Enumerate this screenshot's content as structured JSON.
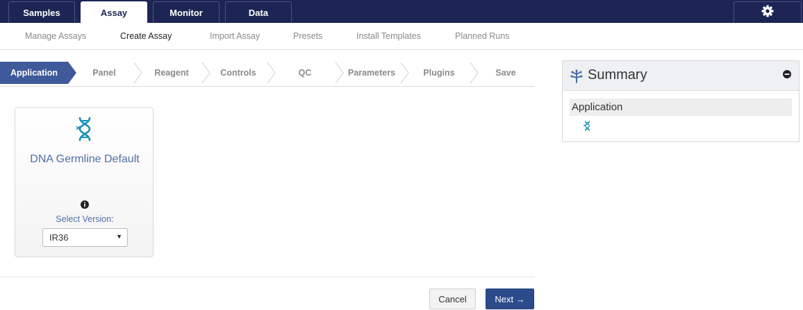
{
  "top_tabs": [
    {
      "label": "Samples",
      "active": false
    },
    {
      "label": "Assay",
      "active": true
    },
    {
      "label": "Monitor",
      "active": false
    },
    {
      "label": "Data",
      "active": false
    }
  ],
  "settings_icon": "gear-icon",
  "sub_nav": [
    {
      "label": "Manage Assays",
      "active": false
    },
    {
      "label": "Create Assay",
      "active": true
    },
    {
      "label": "Import Assay",
      "active": false
    },
    {
      "label": "Presets",
      "active": false
    },
    {
      "label": "Install Templates",
      "active": false
    },
    {
      "label": "Planned Runs",
      "active": false
    }
  ],
  "wizard_steps": [
    {
      "label": "Application",
      "active": true
    },
    {
      "label": "Panel",
      "active": false
    },
    {
      "label": "Reagent",
      "active": false
    },
    {
      "label": "Controls",
      "active": false
    },
    {
      "label": "QC",
      "active": false
    },
    {
      "label": "Parameters",
      "active": false
    },
    {
      "label": "Plugins",
      "active": false
    },
    {
      "label": "Save",
      "active": false
    }
  ],
  "assay_card": {
    "icon": "dna-icon",
    "title": "DNA Germline Default",
    "info_icon": "info-icon",
    "version_label": "Select Version:",
    "version_value": "IR36"
  },
  "buttons": {
    "cancel": "Cancel",
    "next": "Next →"
  },
  "summary": {
    "title": "Summary",
    "row_label": "Application",
    "row_icon": "dna-icon"
  },
  "colors": {
    "nav_bg": "#1c2553",
    "active_step": "#3f5a9b",
    "link_blue": "#4f6ea8",
    "next_button": "#2b4b8a",
    "dna_teal": "#1a8fb5"
  }
}
